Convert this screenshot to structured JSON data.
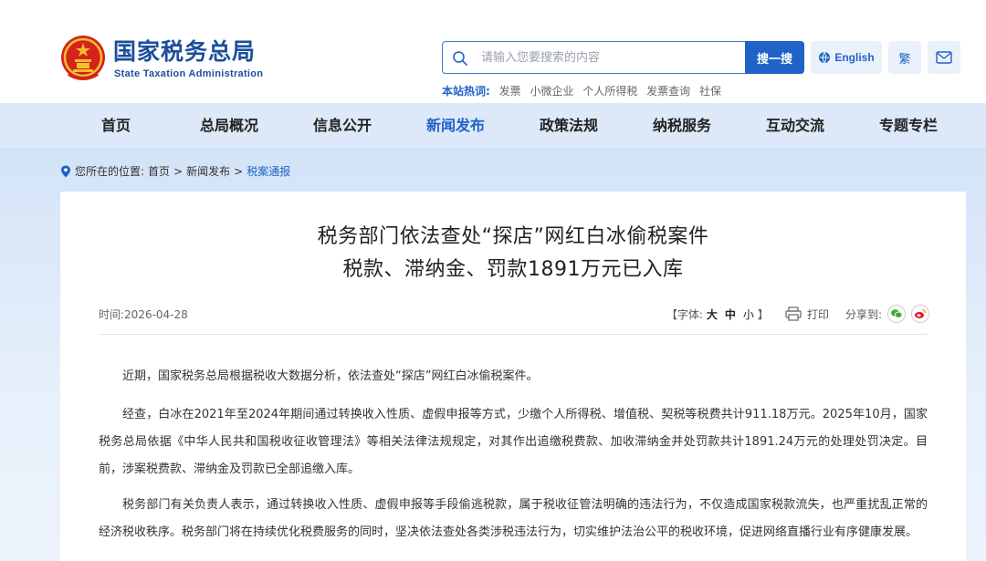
{
  "header": {
    "brand_cn": "国家税务总局",
    "brand_en": "State Taxation Administration",
    "search_placeholder": "请输入您要搜索的内容",
    "search_button": "搜一搜",
    "lang_button": "English",
    "traditional_button": "繁",
    "hotwords_label": "本站热词:",
    "hotwords": [
      "发票",
      "小微企业",
      "个人所得税",
      "发票查询",
      "社保"
    ]
  },
  "nav": {
    "items": [
      "首页",
      "总局概况",
      "信息公开",
      "新闻发布",
      "政策法规",
      "纳税服务",
      "互动交流",
      "专题专栏"
    ],
    "active": "新闻发布"
  },
  "breadcrumb": {
    "prefix": "您所在的位置:",
    "home": "首页",
    "sep": ">",
    "section": "新闻发布",
    "current": "税案通报"
  },
  "article": {
    "title_line1": "税务部门依法查处“探店”网红白冰偷税案件",
    "title_line2": "税款、滞纳金、罚款1891万元已入库",
    "date_label": "时间:",
    "date": "2026-04-28",
    "font_label_open": "【字体:",
    "font_large": "大",
    "font_medium": "中",
    "font_small": "小",
    "font_label_close": "】",
    "print_label": "打印",
    "share_label": "分享到:",
    "paragraphs": [
      "近期，国家税务总局根据税收大数据分析，依法查处“探店”网红白冰偷税案件。",
      "经查，白冰在2021年至2024年期间通过转换收入性质、虚假申报等方式，少缴个人所得税、增值税、契税等税费共计911.18万元。2025年10月，国家税务总局依据《中华人民共和国税收征收管理法》等相关法律法规规定，对其作出追缴税费款、加收滞纳金并处罚款共计1891.24万元的处理处罚决定。目前，涉案税费款、滞纳金及罚款已全部追缴入库。",
      "税务部门有关负责人表示，通过转换收入性质、虚假申报等手段偷逃税款，属于税收征管法明确的违法行为，不仅造成国家税款流失，也严重扰乱正常的经济税收秩序。税务部门将在持续优化税费服务的同时，坚决依法查处各类涉税违法行为，切实维护法治公平的税收环境，促进网络直播行业有序健康发展。"
    ]
  },
  "colors": {
    "brand_blue": "#1b4f9c",
    "accent_blue": "#1f63c6",
    "nav_bg": "#dde9f8"
  }
}
